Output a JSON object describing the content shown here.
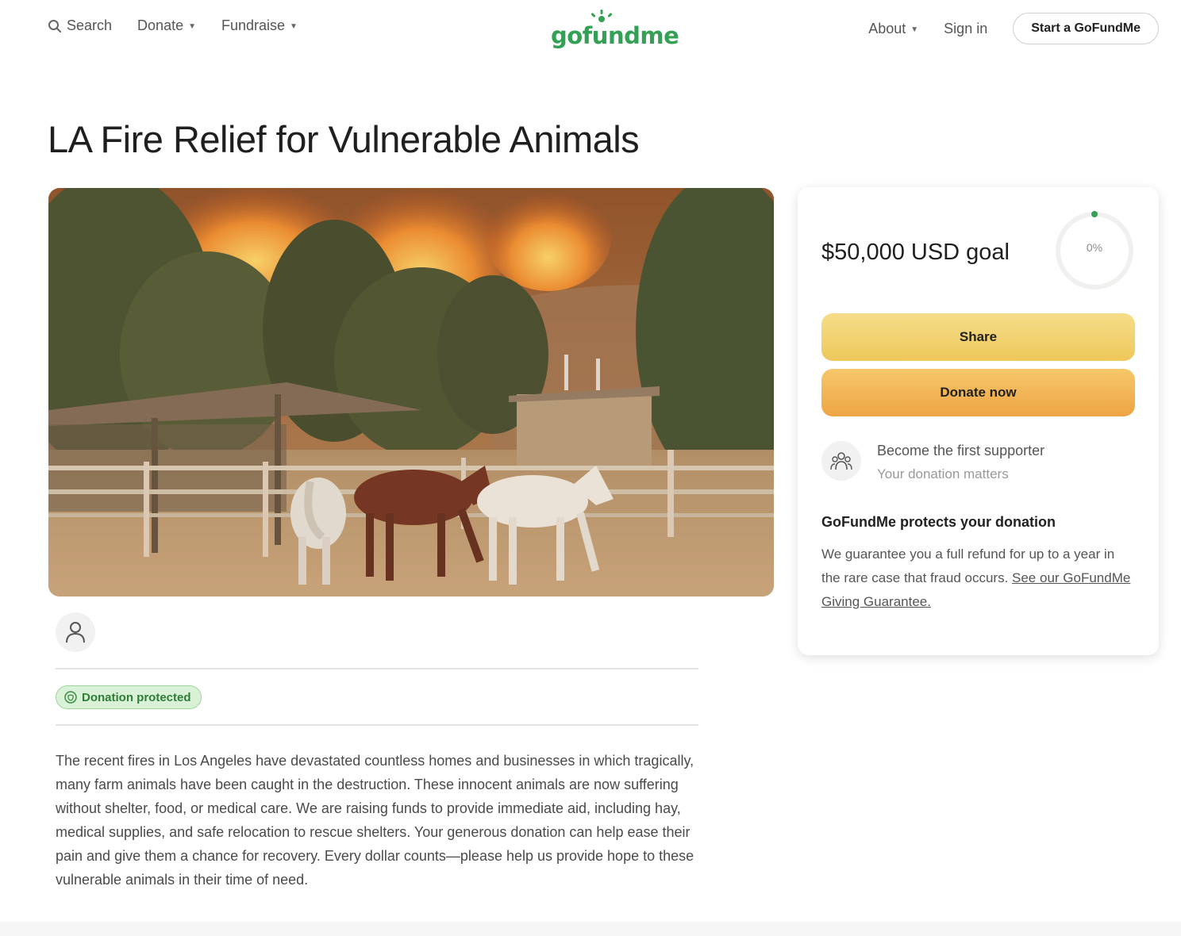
{
  "header": {
    "search_label": "Search",
    "donate_label": "Donate",
    "fundraise_label": "Fundraise",
    "logo_text": "gofundme",
    "about_label": "About",
    "signin_label": "Sign in",
    "start_label": "Start a GoFundMe"
  },
  "page": {
    "title": "LA Fire Relief for Vulnerable Animals",
    "badge_label": "Donation protected",
    "story": "The recent fires in Los Angeles have devastated countless homes and businesses in which tragically, many farm animals have been caught in the destruction. These innocent animals are now suffering without shelter, food, or medical care. We are raising funds to provide immediate aid, including hay, medical supplies, and safe relocation to rescue shelters. Your generous donation can help ease their pain and give them a chance for recovery. Every dollar counts—please help us provide hope to these vulnerable animals in their time of need."
  },
  "card": {
    "goal": "$50,000 USD goal",
    "progress_label": "0%",
    "progress_fraction": 0,
    "share_label": "Share",
    "donate_label": "Donate now",
    "supporter_title": "Become the first supporter",
    "supporter_sub": "Your donation matters",
    "protect_title": "GoFundMe protects your donation",
    "protect_text": "We guarantee you a full refund for up to a year in the rare case that fraud occurs. ",
    "protect_link": "See our GoFundMe Giving Guarantee."
  },
  "colors": {
    "brand_green": "#33a153",
    "share_yellow": "#eec75a",
    "donate_orange": "#eda444",
    "badge_green": "#d9f2d7"
  },
  "icons": {
    "search": "search-icon",
    "caret": "chevron-down-icon",
    "user": "user-icon",
    "shield": "shield-icon",
    "supporters": "supporters-icon"
  }
}
